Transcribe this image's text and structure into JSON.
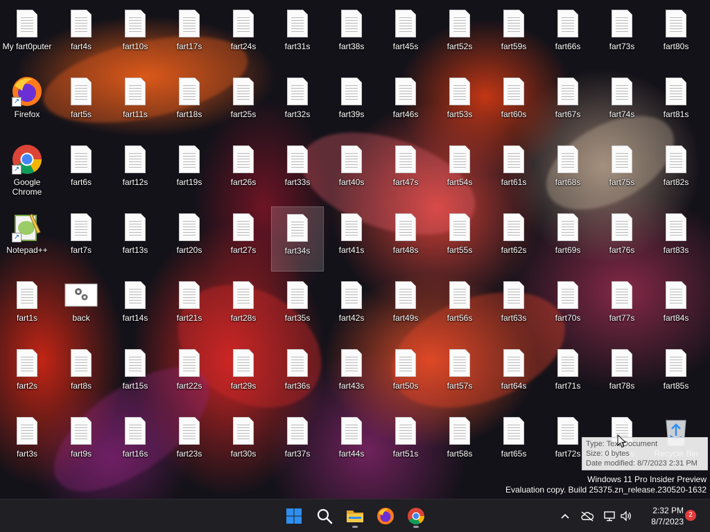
{
  "desktop_icons": [
    {
      "label": "My fart0puter",
      "type": "doc"
    },
    {
      "label": "Firefox",
      "type": "firefox"
    },
    {
      "label": "Google Chrome",
      "type": "chrome"
    },
    {
      "label": "Notepad++",
      "type": "notepadpp"
    },
    {
      "label": "fart1s",
      "type": "doc"
    },
    {
      "label": "fart2s",
      "type": "doc"
    },
    {
      "label": "fart3s",
      "type": "doc"
    },
    {
      "label": "fart4s",
      "type": "doc"
    },
    {
      "label": "fart5s",
      "type": "doc"
    },
    {
      "label": "fart6s",
      "type": "doc"
    },
    {
      "label": "fart7s",
      "type": "doc"
    },
    {
      "label": "back",
      "type": "back"
    },
    {
      "label": "fart8s",
      "type": "doc"
    },
    {
      "label": "fart9s",
      "type": "doc"
    },
    {
      "label": "fart10s",
      "type": "doc"
    },
    {
      "label": "fart11s",
      "type": "doc"
    },
    {
      "label": "fart12s",
      "type": "doc"
    },
    {
      "label": "fart13s",
      "type": "doc"
    },
    {
      "label": "fart14s",
      "type": "doc"
    },
    {
      "label": "fart15s",
      "type": "doc"
    },
    {
      "label": "fart16s",
      "type": "doc"
    },
    {
      "label": "fart17s",
      "type": "doc"
    },
    {
      "label": "fart18s",
      "type": "doc"
    },
    {
      "label": "fart19s",
      "type": "doc"
    },
    {
      "label": "fart20s",
      "type": "doc"
    },
    {
      "label": "fart21s",
      "type": "doc"
    },
    {
      "label": "fart22s",
      "type": "doc"
    },
    {
      "label": "fart23s",
      "type": "doc"
    },
    {
      "label": "fart24s",
      "type": "doc"
    },
    {
      "label": "fart25s",
      "type": "doc"
    },
    {
      "label": "fart26s",
      "type": "doc"
    },
    {
      "label": "fart27s",
      "type": "doc"
    },
    {
      "label": "fart28s",
      "type": "doc"
    },
    {
      "label": "fart29s",
      "type": "doc"
    },
    {
      "label": "fart30s",
      "type": "doc"
    },
    {
      "label": "fart31s",
      "type": "doc"
    },
    {
      "label": "fart32s",
      "type": "doc"
    },
    {
      "label": "fart33s",
      "type": "doc"
    },
    {
      "label": "fart34s",
      "type": "doc",
      "selected": true
    },
    {
      "label": "fart35s",
      "type": "doc"
    },
    {
      "label": "fart36s",
      "type": "doc"
    },
    {
      "label": "fart37s",
      "type": "doc"
    },
    {
      "label": "fart38s",
      "type": "doc"
    },
    {
      "label": "fart39s",
      "type": "doc"
    },
    {
      "label": "fart40s",
      "type": "doc"
    },
    {
      "label": "fart41s",
      "type": "doc"
    },
    {
      "label": "fart42s",
      "type": "doc"
    },
    {
      "label": "fart43s",
      "type": "doc"
    },
    {
      "label": "fart44s",
      "type": "doc"
    },
    {
      "label": "fart45s",
      "type": "doc"
    },
    {
      "label": "fart46s",
      "type": "doc"
    },
    {
      "label": "fart47s",
      "type": "doc"
    },
    {
      "label": "fart48s",
      "type": "doc"
    },
    {
      "label": "fart49s",
      "type": "doc"
    },
    {
      "label": "fart50s",
      "type": "doc"
    },
    {
      "label": "fart51s",
      "type": "doc"
    },
    {
      "label": "fart52s",
      "type": "doc"
    },
    {
      "label": "fart53s",
      "type": "doc"
    },
    {
      "label": "fart54s",
      "type": "doc"
    },
    {
      "label": "fart55s",
      "type": "doc"
    },
    {
      "label": "fart56s",
      "type": "doc"
    },
    {
      "label": "fart57s",
      "type": "doc"
    },
    {
      "label": "fart58s",
      "type": "doc"
    },
    {
      "label": "fart59s",
      "type": "doc"
    },
    {
      "label": "fart60s",
      "type": "doc"
    },
    {
      "label": "fart61s",
      "type": "doc"
    },
    {
      "label": "fart62s",
      "type": "doc"
    },
    {
      "label": "fart63s",
      "type": "doc"
    },
    {
      "label": "fart64s",
      "type": "doc"
    },
    {
      "label": "fart65s",
      "type": "doc"
    },
    {
      "label": "fart66s",
      "type": "doc"
    },
    {
      "label": "fart67s",
      "type": "doc"
    },
    {
      "label": "fart68s",
      "type": "doc"
    },
    {
      "label": "fart69s",
      "type": "doc"
    },
    {
      "label": "fart70s",
      "type": "doc"
    },
    {
      "label": "fart71s",
      "type": "doc"
    },
    {
      "label": "fart72s",
      "type": "doc"
    },
    {
      "label": "fart73s",
      "type": "doc"
    },
    {
      "label": "fart74s",
      "type": "doc"
    },
    {
      "label": "fart75s",
      "type": "doc"
    },
    {
      "label": "fart76s",
      "type": "doc"
    },
    {
      "label": "fart77s",
      "type": "doc"
    },
    {
      "label": "fart78s",
      "type": "doc"
    },
    {
      "label": "fart79s",
      "type": "doc"
    },
    {
      "label": "fart80s",
      "type": "doc"
    },
    {
      "label": "fart81s",
      "type": "doc"
    },
    {
      "label": "fart82s",
      "type": "doc"
    },
    {
      "label": "fart83s",
      "type": "doc"
    },
    {
      "label": "fart84s",
      "type": "doc"
    },
    {
      "label": "fart85s",
      "type": "doc"
    },
    {
      "label": "Recycle Bin",
      "type": "recycle"
    }
  ],
  "tooltip": {
    "type_line": "Type: Text Document",
    "size_line": "Size: 0 bytes",
    "date_line": "Date modified: 8/7/2023 2:31 PM"
  },
  "watermark": {
    "line1": "Windows 11 Pro Insider Preview",
    "line2": "Evaluation copy. Build 25375.zn_release.230520-1632"
  },
  "taskbar": {
    "pinned": [
      {
        "name": "start-button",
        "icon": "windows-logo-icon"
      },
      {
        "name": "search-button",
        "icon": "search-icon"
      },
      {
        "name": "file-explorer-button",
        "icon": "folder-icon"
      },
      {
        "name": "firefox-taskbar-button",
        "icon": "firefox-icon"
      },
      {
        "name": "chrome-taskbar-button",
        "icon": "chrome-icon"
      }
    ],
    "clock": {
      "time": "2:32 PM",
      "date": "8/7/2023"
    },
    "notification_count": "2"
  },
  "colors": {
    "taskbar_bg": "#1f1f24",
    "accent_blue": "#2f8ff0",
    "badge_red": "#e03c3c"
  }
}
